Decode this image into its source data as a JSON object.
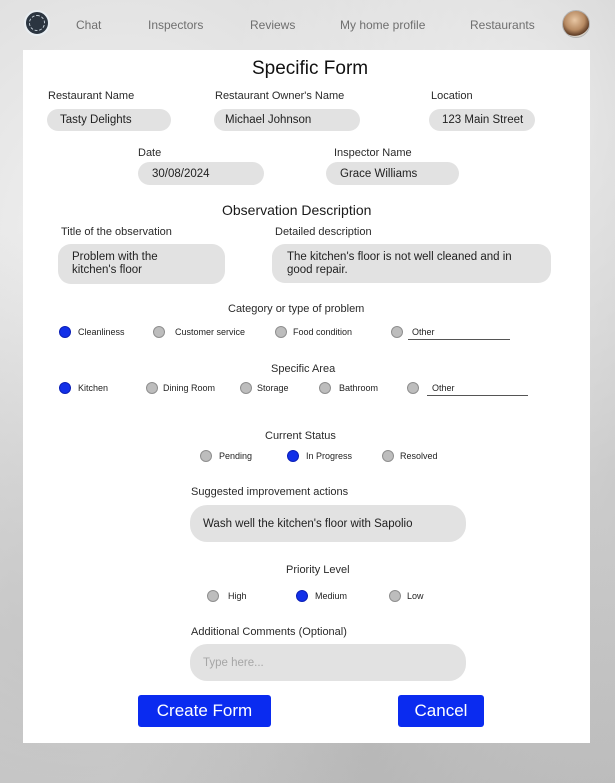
{
  "nav": {
    "items": [
      "Chat",
      "Inspectors",
      "Reviews",
      "My home profile",
      "Restaurants"
    ]
  },
  "form": {
    "title": "Specific Form",
    "restaurant_name": {
      "label": "Restaurant Name",
      "value": "Tasty Delights"
    },
    "owner_name": {
      "label": "Restaurant Owner's Name",
      "value": "Michael Johnson"
    },
    "location": {
      "label": "Location",
      "value": "123 Main Street"
    },
    "date": {
      "label": "Date",
      "value": "30/08/2024"
    },
    "inspector_name": {
      "label": "Inspector Name",
      "value": "Grace Williams"
    },
    "observation_heading": "Observation Description",
    "obs_title": {
      "label": "Title of the observation",
      "value": "Problem with the kitchen's floor"
    },
    "detailed": {
      "label": "Detailed description",
      "value": "The kitchen's floor is not well cleaned and in good repair."
    },
    "category": {
      "label": "Category or type of problem",
      "options": [
        "Cleanliness",
        "Customer service",
        "Food condition",
        "Other"
      ],
      "selected": "Cleanliness"
    },
    "area": {
      "label": "Specific Area",
      "options": [
        "Kitchen",
        "Dining Room",
        "Storage",
        "Bathroom",
        "Other"
      ],
      "selected": "Kitchen"
    },
    "status": {
      "label": "Current Status",
      "options": [
        "Pending",
        "In Progress",
        "Resolved"
      ],
      "selected": "In Progress"
    },
    "suggested": {
      "label": "Suggested improvement actions",
      "value": "Wash well the kitchen's floor with Sapolio"
    },
    "priority": {
      "label": "Priority Level",
      "options": [
        "High",
        "Medium",
        "Low"
      ],
      "selected": "Medium"
    },
    "comments": {
      "label": "Additional Comments (Optional)",
      "placeholder": "Type here..."
    },
    "create_label": "Create Form",
    "cancel_label": "Cancel"
  },
  "colors": {
    "accent": "#0a2bf0",
    "radio_selected": "#1230e8",
    "field_bg": "#e2e2e2"
  }
}
